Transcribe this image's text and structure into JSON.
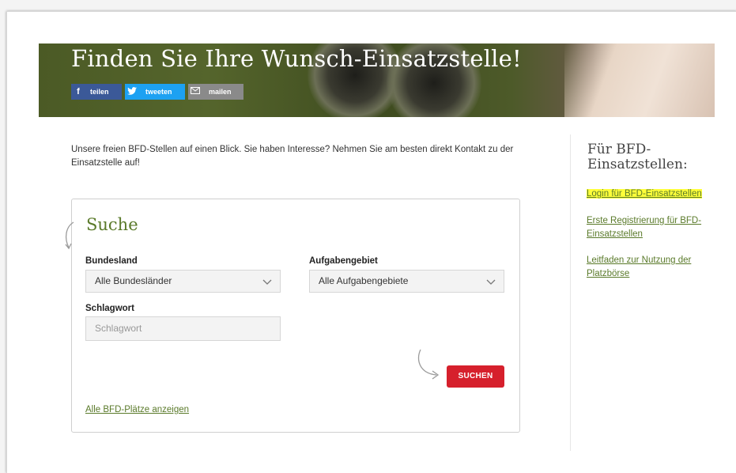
{
  "hero": {
    "title": "Finden Sie Ihre Wunsch-Einsatzstelle!",
    "share": [
      {
        "label": "teilen",
        "icon": "facebook-icon",
        "color": "#3b5998"
      },
      {
        "label": "tweeten",
        "icon": "twitter-icon",
        "color": "#1da1f2"
      },
      {
        "label": "mailen",
        "icon": "mail-icon",
        "color": "#8a8a8a"
      }
    ]
  },
  "intro": "Unsere freien BFD-Stellen auf einen Blick. Sie haben Interesse? Nehmen Sie am besten direkt Kontakt zu der Einsatzstelle auf!",
  "search": {
    "title": "Suche",
    "bundesland": {
      "label": "Bundesland",
      "value": "Alle Bundesländer"
    },
    "aufgabengebiet": {
      "label": "Aufgabengebiet",
      "value": "Alle Aufgabengebiete"
    },
    "schlagwort": {
      "label": "Schlagwort",
      "placeholder": "Schlagwort"
    },
    "button": "SUCHEN",
    "all_link": "Alle BFD-Plätze anzeigen"
  },
  "sidebar": {
    "title": "Für BFD-Einsatzstellen:",
    "links": [
      {
        "label": "Login für BFD-Einsatzstellen",
        "highlighted": true
      },
      {
        "label": "Erste Registrierung für BFD-Einsatzstellen"
      },
      {
        "label": "Leitfaden zur Nutzung der Platzbörse"
      }
    ]
  },
  "colors": {
    "accent": "#5a7a2a",
    "button": "#d6202c",
    "highlight": "#ffff3a"
  }
}
